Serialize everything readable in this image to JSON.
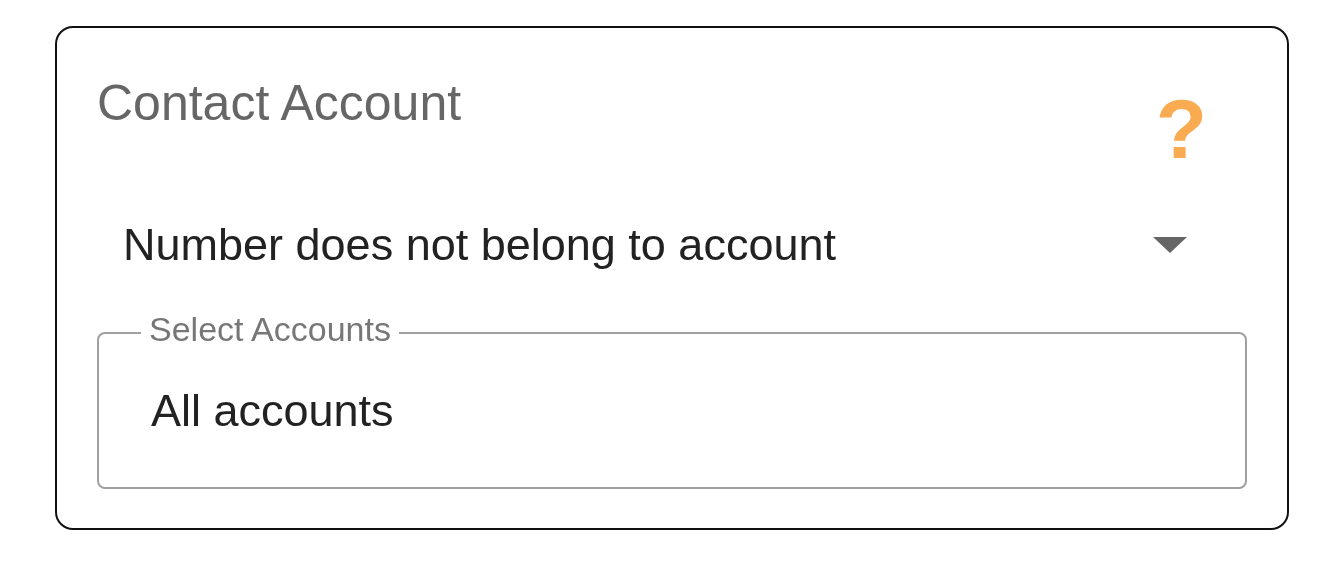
{
  "title": "Contact Account",
  "help_glyph": "?",
  "select": {
    "value": "Number does not belong to account"
  },
  "accounts_field": {
    "label": "Select Accounts",
    "value": "All accounts"
  }
}
